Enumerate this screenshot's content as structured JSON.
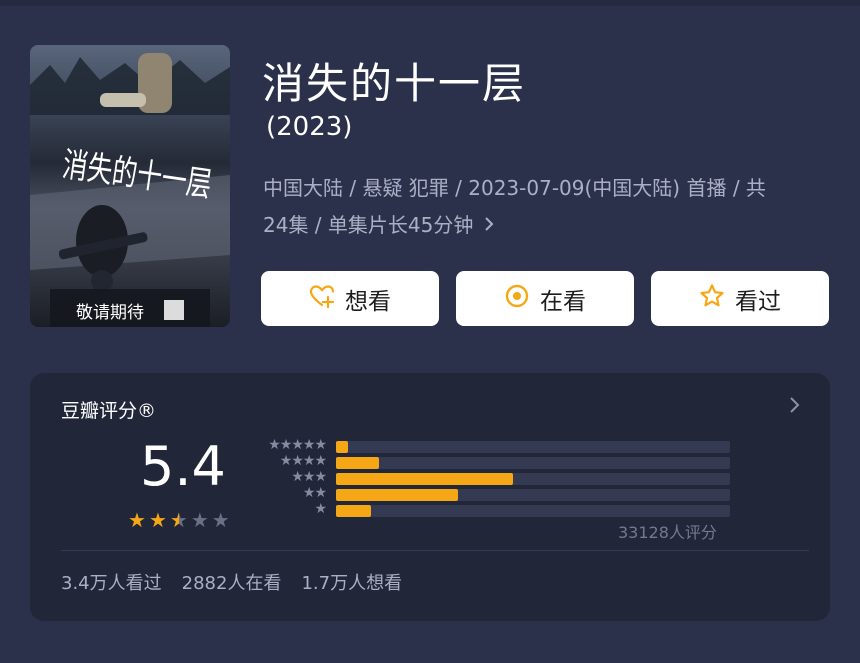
{
  "movie": {
    "title": "消失的十一层",
    "year": "(2023)",
    "meta_line1": "中国大陆 / 悬疑 犯罪 / 2023-07-09(中国大陆) 首播 / 共",
    "meta_line2": "24集 / 单集片长45分钟",
    "poster_title": "消失的十一层",
    "poster_tagline": "敬请期待"
  },
  "actions": [
    {
      "label": "想看",
      "icon": "heart-plus-icon"
    },
    {
      "label": "在看",
      "icon": "target-icon"
    },
    {
      "label": "看过",
      "icon": "star-outline-icon"
    }
  ],
  "rating": {
    "section_title": "豆瓣评分®",
    "score": "5.4",
    "stars": 2.5,
    "distribution": [
      {
        "stars": 5,
        "fraction": 0.03
      },
      {
        "stars": 4,
        "fraction": 0.11
      },
      {
        "stars": 3,
        "fraction": 0.45
      },
      {
        "stars": 2,
        "fraction": 0.31
      },
      {
        "stars": 1,
        "fraction": 0.09
      }
    ],
    "count_text": "33128人评分"
  },
  "stats": {
    "watched": "3.4万人看过",
    "watching": "2882人在看",
    "want": "1.7万人想看"
  },
  "colors": {
    "background": "#2c314b",
    "panel": "#212639",
    "accent": "#f6a716",
    "button": "#ffffff"
  }
}
